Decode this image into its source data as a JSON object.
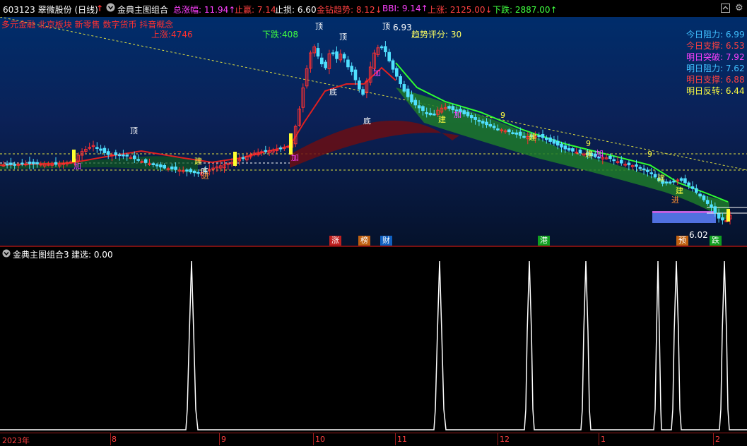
{
  "header": {
    "code_name": "603123 翠微股份 (日线)",
    "up_arrow": "↑",
    "indicator_name": "金典主图组合",
    "stats": [
      {
        "text": "总涨幅: 11.94↑",
        "color": "#ff40ff"
      },
      {
        "text": "止赢: 7.14",
        "color": "#ff4040"
      },
      {
        "text": "止损: 6.60",
        "color": "#ffffff"
      },
      {
        "text": "金钻趋势: 8.12↓",
        "color": "#ff4040"
      },
      {
        "text": "BBI: 9.14↑",
        "color": "#ff40ff"
      },
      {
        "text": "上涨: 2125.00↓",
        "color": "#ff4040"
      },
      {
        "text": "下跌: 2887.00↑",
        "color": "#40ff40"
      }
    ]
  },
  "concepts": "多元金融 北京板块 新零售 数字货币 抖音概念",
  "main_labels": {
    "up_count": "上涨:4746",
    "down_count": "下跌:408",
    "trend_score": "趋势评分:  30",
    "price_high": "6.93",
    "price_low": "6.02"
  },
  "levels": [
    {
      "text": "今日阻力: 6.99",
      "color": "#40c0ff"
    },
    {
      "text": "今日支撑: 6.53",
      "color": "#ff4040"
    },
    {
      "text": "明日突破: 7.92",
      "color": "#ff40ff"
    },
    {
      "text": "明日阻力: 7.62",
      "color": "#40c0ff"
    },
    {
      "text": "明日支撑: 6.88",
      "color": "#ff4040"
    },
    {
      "text": "明日反转: 6.44",
      "color": "#ffff40"
    }
  ],
  "badges": [
    {
      "text": "涨",
      "color": "#c02020"
    },
    {
      "text": "榜",
      "color": "#c06010"
    },
    {
      "text": "财",
      "color": "#1060c0"
    },
    {
      "text": "港",
      "color": "#10a020"
    },
    {
      "text": "预",
      "color": "#c06010"
    },
    {
      "text": "跌",
      "color": "#10a020"
    }
  ],
  "sub_panel": {
    "title": "金典主图组合3",
    "value_label": "建选: 0.00"
  },
  "dates": [
    "2023年",
    "8",
    "9",
    "10",
    "11",
    "12",
    "1",
    "2"
  ],
  "signals": [
    "顶",
    "底",
    "加",
    "建",
    "进",
    "9"
  ],
  "icon_names": [
    "chevron-down-icon",
    "up-arrow-icon",
    "maximize-icon",
    "gear-icon"
  ]
}
